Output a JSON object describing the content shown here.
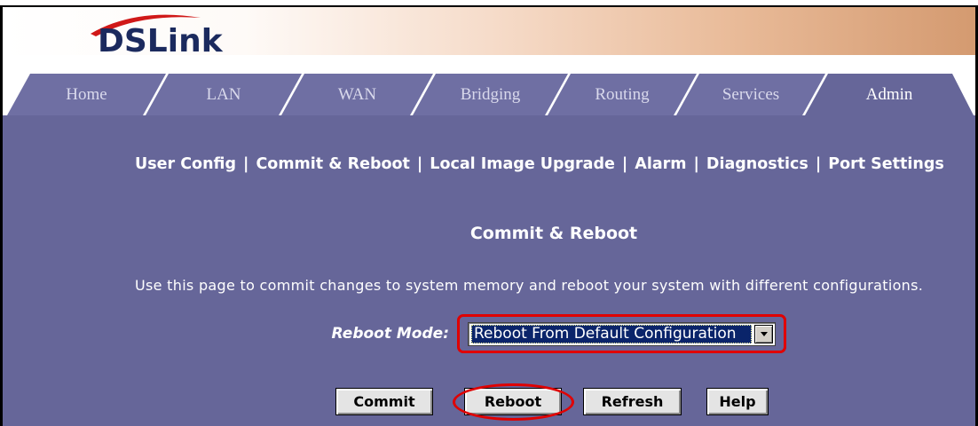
{
  "header": {
    "logo_text": "DSLink"
  },
  "tabs": [
    {
      "label": "Home",
      "active": false
    },
    {
      "label": "LAN",
      "active": false
    },
    {
      "label": "WAN",
      "active": false
    },
    {
      "label": "Bridging",
      "active": false
    },
    {
      "label": "Routing",
      "active": false
    },
    {
      "label": "Services",
      "active": false
    },
    {
      "label": "Admin",
      "active": true
    }
  ],
  "subnav": {
    "separator": "|",
    "items": [
      {
        "label": "User Config"
      },
      {
        "label": "Commit & Reboot"
      },
      {
        "label": "Local Image Upgrade"
      },
      {
        "label": "Alarm"
      },
      {
        "label": "Diagnostics"
      },
      {
        "label": "Port Settings"
      }
    ]
  },
  "page": {
    "title": "Commit & Reboot",
    "description": "Use this page to commit changes to system memory and reboot your system with different configurations."
  },
  "reboot_mode": {
    "label": "Reboot Mode:",
    "selected": "Reboot From Default Configuration"
  },
  "buttons": {
    "commit": "Commit",
    "reboot": "Reboot",
    "refresh": "Refresh",
    "help": "Help"
  },
  "icons": {
    "dropdown": "chevron-down-icon"
  },
  "colors": {
    "content_bg": "#666699",
    "tab_bg": "#6f6fa3",
    "tab_text": "#d9d9ec",
    "annotation_red": "#e00000",
    "logo_navy": "#1b2a5e",
    "logo_red": "#d01818",
    "selection_bg": "#0a246a"
  }
}
